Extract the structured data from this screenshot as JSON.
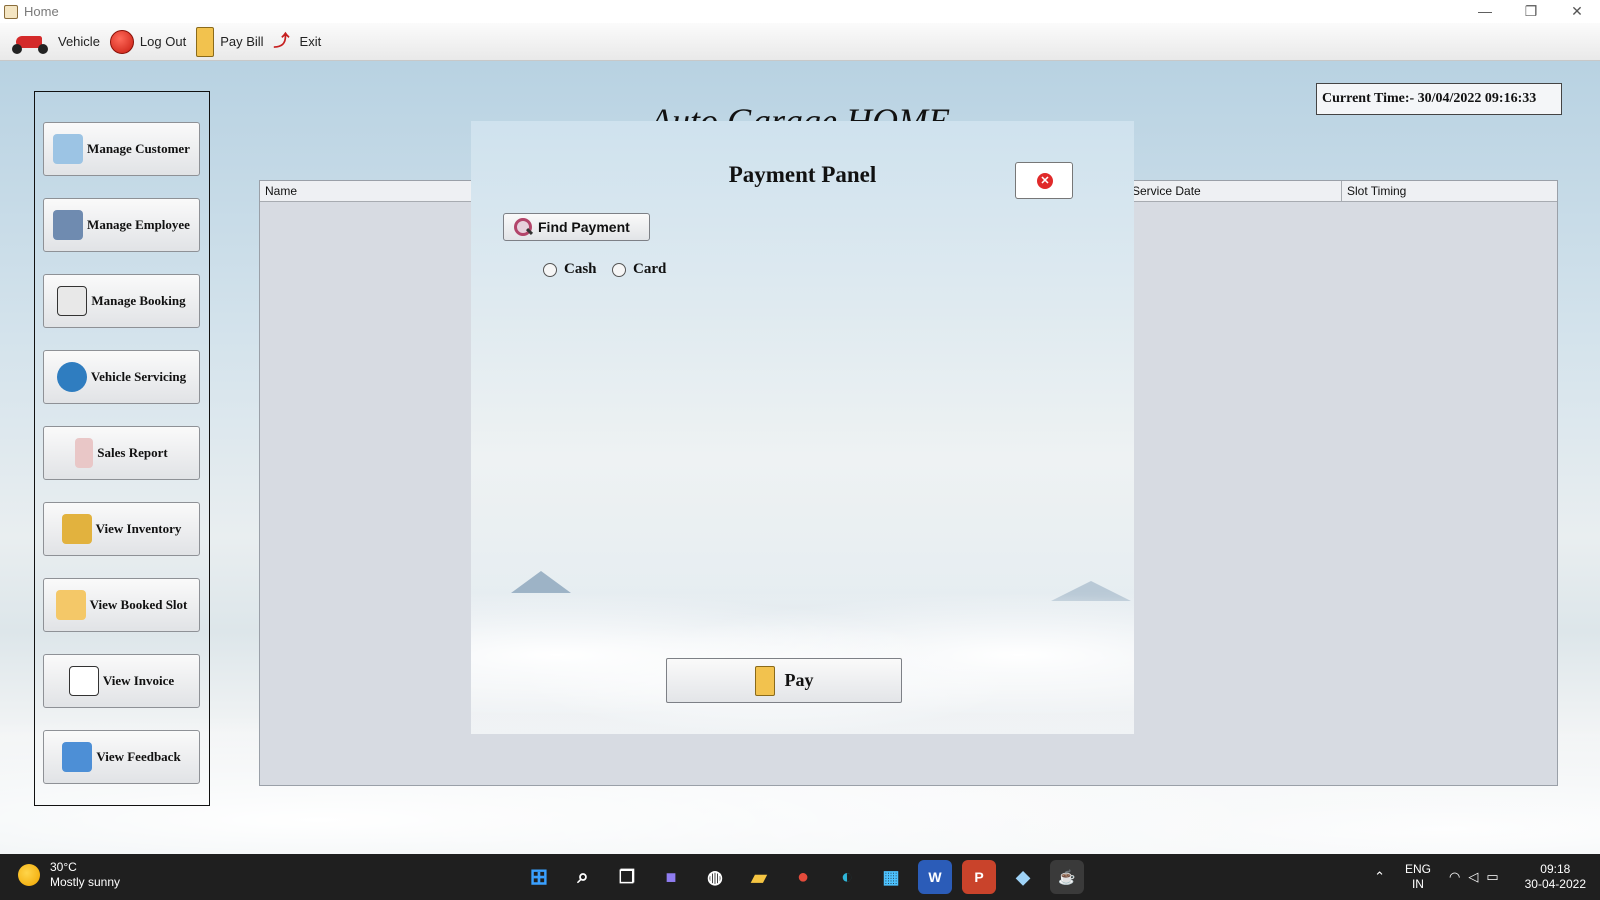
{
  "window": {
    "title": "Home"
  },
  "toolbar": {
    "items": [
      {
        "label": "Vehicle",
        "icon": "scooter-icon"
      },
      {
        "label": "Log Out",
        "icon": "logout-icon"
      },
      {
        "label": "Pay Bill",
        "icon": "bill-icon"
      },
      {
        "label": "Exit",
        "icon": "exit-icon"
      }
    ]
  },
  "sidebar": {
    "items": [
      {
        "label": "Manage Customer",
        "icon": "customer-icon"
      },
      {
        "label": "Manage Employee",
        "icon": "employee-icon"
      },
      {
        "label": "Manage Booking",
        "icon": "booking-icon"
      },
      {
        "label": "Vehicle Servicing",
        "icon": "gear-wrench-icon"
      },
      {
        "label": "Sales Report",
        "icon": "report-icon"
      },
      {
        "label": "View Inventory",
        "icon": "inventory-icon"
      },
      {
        "label": "View Booked Slot",
        "icon": "calendar-icon"
      },
      {
        "label": "View Invoice",
        "icon": "invoice-icon"
      },
      {
        "label": "View Feedback",
        "icon": "feedback-icon"
      }
    ]
  },
  "main": {
    "heading": "Auto Garage HOME",
    "clock": "Current Time:- 30/04/2022 09:16:33",
    "table": {
      "columns": [
        "Name",
        "Service Date",
        "Slot Timing"
      ]
    }
  },
  "payment_dialog": {
    "title": "Payment Panel",
    "find_label": "Find Payment",
    "options": [
      "Cash",
      "Card"
    ],
    "pay_label": "Pay",
    "colors": {
      "close_icon": "#e02a2a"
    }
  },
  "taskbar": {
    "weather": {
      "temp": "30°C",
      "condition": "Mostly sunny"
    },
    "language": {
      "line1": "ENG",
      "line2": "IN"
    },
    "time": "09:18",
    "date": "30-04-2022"
  }
}
